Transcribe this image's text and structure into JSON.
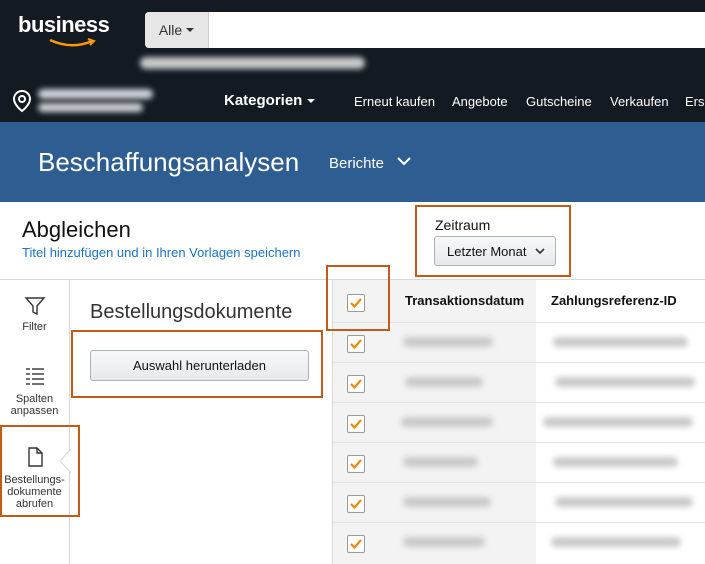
{
  "header": {
    "logo_text": "business",
    "search_category": "Alle",
    "nav": {
      "categories": "Kategorien",
      "items": [
        "Erneut kaufen",
        "Angebote",
        "Gutscheine",
        "Verkaufen",
        "Ers"
      ]
    }
  },
  "band": {
    "title": "Beschaffungsanalysen",
    "reports": "Berichte"
  },
  "page": {
    "title": "Abgleichen",
    "link": "Titel hinzufügen und in Ihren Vorlagen speichern",
    "period_label": "Zeitraum",
    "period_value": "Letzter Monat"
  },
  "rail": {
    "filter": "Filter",
    "columns_line1": "Spalten",
    "columns_line2": "anpassen",
    "docs_line1": "Bestellungs-",
    "docs_line2": "dokumente",
    "docs_line3": "abrufen"
  },
  "panel": {
    "title": "Bestellungsdokumente",
    "download_button": "Auswahl herunterladen"
  },
  "table": {
    "headers": {
      "date": "Transaktionsdatum",
      "ref": "Zahlungsreferenz-ID"
    },
    "row_count": 6,
    "all_checked": true
  },
  "colors": {
    "nav_bg": "#131a22",
    "band_bg": "#2e5e91",
    "highlight": "#c45a17",
    "check": "#f08804",
    "link": "#1a73c7"
  }
}
